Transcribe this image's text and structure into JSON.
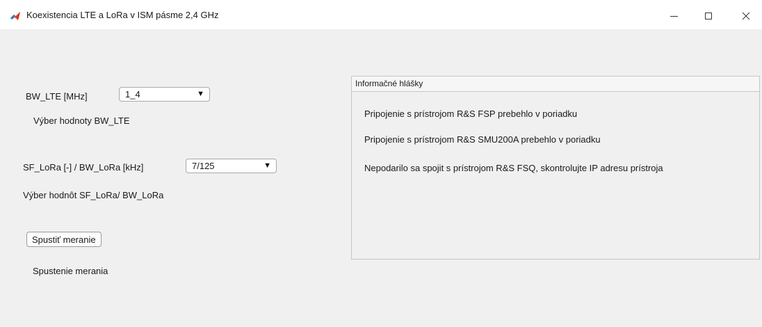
{
  "window": {
    "title": "Koexistencia LTE a LoRa v ISM pásme 2,4 GHz",
    "icon": "matlab-icon",
    "controls": [
      "minimize-icon",
      "maximize-icon",
      "close-icon"
    ]
  },
  "bw_lte": {
    "label": "BW_LTE [MHz]",
    "selected": "1_4",
    "caption": "Výber hodnoty BW_LTE"
  },
  "sf_lora": {
    "label": "SF_LoRa [-] / BW_LoRa [kHz]",
    "selected": "7/125",
    "caption": "Výber hodnôt SF_LoRa/ BW_LoRa"
  },
  "measurement": {
    "button_label": "Spustiť meranie",
    "caption": "Spustenie merania"
  },
  "info_panel": {
    "title": "Informačné hlášky",
    "messages": [
      "Pripojenie s prístrojom R&S FSP prebehlo v poriadku",
      "Pripojenie s prístrojom R&S SMU200A prebehlo v poriadku",
      "Nepodarilo sa spojit s prístrojom R&S FSQ, skontrolujte IP adresu prístroja"
    ]
  },
  "colors": {
    "background": "#f0f0f0",
    "titlebar": "#ffffff",
    "panel_border": "#c6c6c6"
  }
}
